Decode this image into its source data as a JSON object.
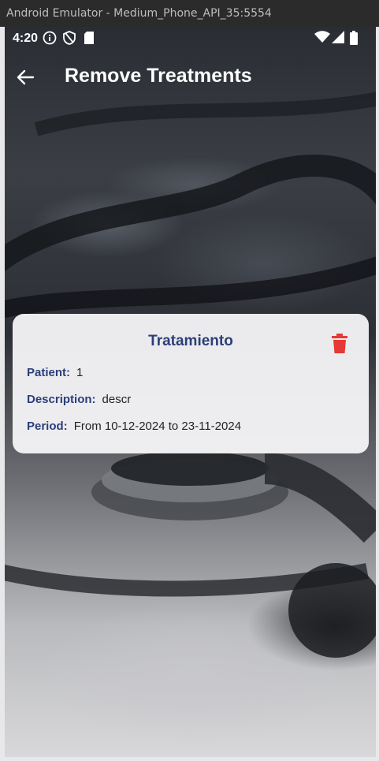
{
  "window_title": "Android Emulator - Medium_Phone_API_35:5554",
  "status_bar": {
    "time": "4:20"
  },
  "app_bar": {
    "title": "Remove Treatments"
  },
  "card": {
    "title": "Tratamiento",
    "patient_label": "Patient:",
    "patient_value": "1",
    "description_label": "Description:",
    "description_value": "descr",
    "period_label": "Period:",
    "period_value": "From 10-12-2024 to 23-11-2024"
  },
  "colors": {
    "accent": "#2c3e78",
    "delete": "#e53935"
  },
  "icons": [
    "back-arrow-icon",
    "info-icon",
    "shield-icon",
    "sd-card-icon",
    "wifi-icon",
    "signal-icon",
    "battery-icon",
    "trash-icon"
  ]
}
